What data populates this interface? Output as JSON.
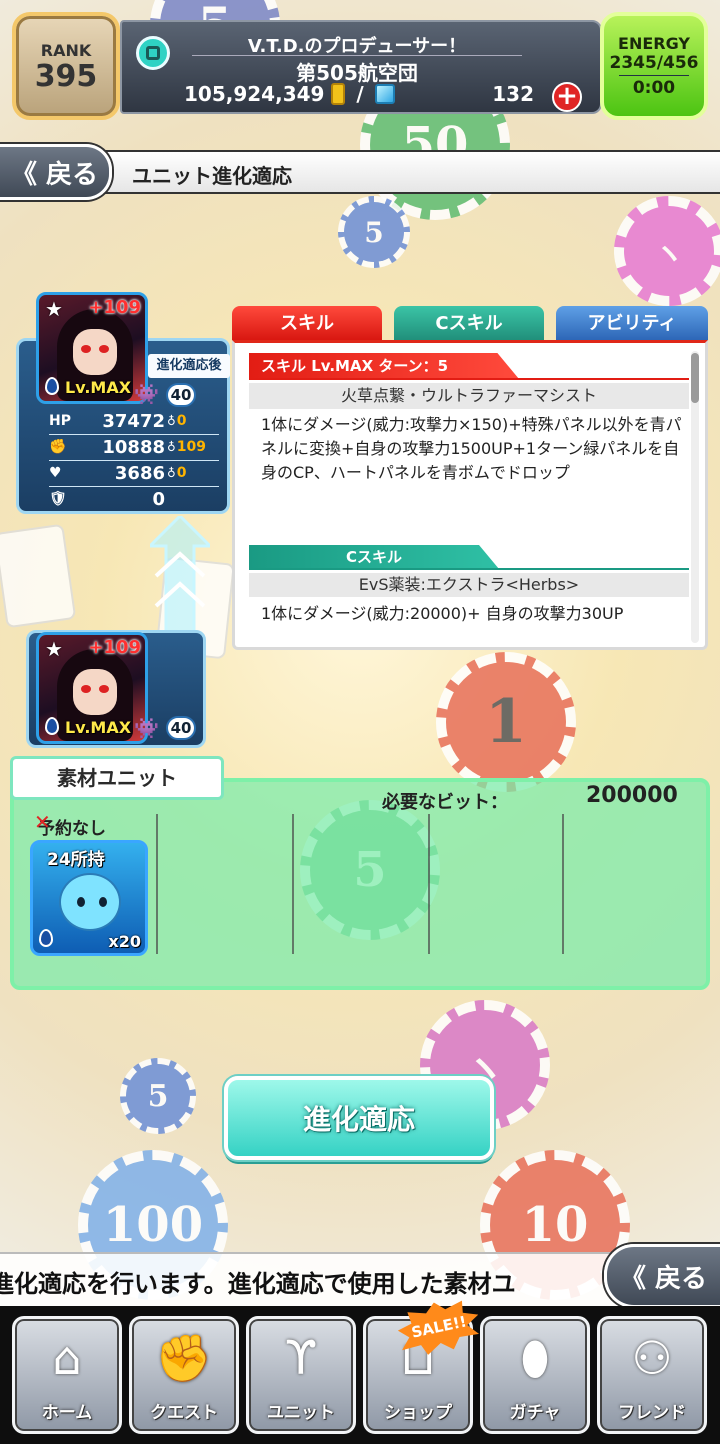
{
  "header": {
    "rank_label": "RANK",
    "rank_value": "395",
    "username": "V.T.D.のプロデューサー！",
    "team_name": "第505航空団",
    "money": "105,924,349",
    "slash": "/",
    "gems": "132",
    "energy_label": "ENERGY",
    "energy_value": "2345/456",
    "energy_timer": "0:00"
  },
  "nav": {
    "back_label": "《 戻る",
    "title": "ユニット進化適応"
  },
  "evolved_unit": {
    "label": "進化適応後",
    "plus": "+109",
    "level": "Lv.MAX",
    "level_badge": "40",
    "stats": [
      {
        "key": "HP",
        "value": "37472",
        "delta": "0"
      },
      {
        "key": "✊",
        "value": "10888",
        "delta": "109"
      },
      {
        "key": "♥",
        "value": "3686",
        "delta": "0"
      },
      {
        "key": "🛡",
        "value": "0",
        "delta": ""
      }
    ]
  },
  "base_unit": {
    "plus": "+109",
    "level": "Lv.MAX",
    "level_badge": "40"
  },
  "skills": {
    "tabs": [
      "スキル",
      "Cスキル",
      "アビリティ"
    ],
    "skill_header": "スキル Lv.MAX ターン：5",
    "skill_name": "火草点繋・ウルトラファーマシスト",
    "skill_desc": "1体にダメージ(威力:攻撃力×150)+特殊パネル以外を青パネルに変換+自身の攻撃力1500UP+1ターン緑パネルを自身のCP、ハートパネルを青ボムでドロップ",
    "cskill_header": "Cスキル",
    "cskill_name": "EvS薬装:エクストラ<Herbs>",
    "cskill_desc": "1体にダメージ(威力:20000)+ 自身の攻撃力30UP"
  },
  "materials": {
    "label": "素材ユニット",
    "bits_label": "必要なビット：",
    "bits_value": "200000",
    "no_reserve": "予約なし",
    "owned": "24所持",
    "quantity": "x20"
  },
  "action": {
    "evolve_label": "進化適応"
  },
  "ticker": {
    "text": "進化適応を行います。進化適応で使用した素材ユ",
    "back_label": "《 戻る"
  },
  "footer": {
    "items": [
      {
        "label": "ホーム",
        "icon": "home-icon"
      },
      {
        "label": "クエスト",
        "icon": "handshake-icon"
      },
      {
        "label": "ユニット",
        "icon": "rabbit-icon"
      },
      {
        "label": "ショップ",
        "icon": "cart-icon"
      },
      {
        "label": "ガチャ",
        "icon": "egg-icon"
      },
      {
        "label": "フレンド",
        "icon": "people-icon"
      }
    ],
    "sale_badge": "SALE!!"
  },
  "colors": {
    "skill_red": "#e21d14",
    "cskill_teal": "#1a9a83",
    "ability_blue": "#2a63b4",
    "material_green": "#79ecaa",
    "evolve_button": "#35d2c4"
  }
}
